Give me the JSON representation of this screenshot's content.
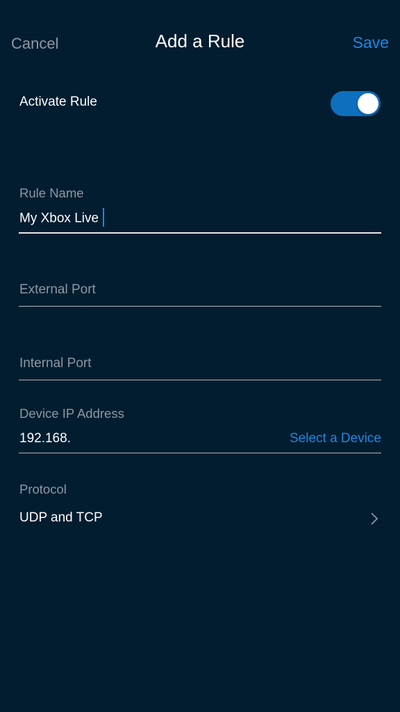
{
  "nav": {
    "cancel_label": "Cancel",
    "title": "Add a Rule",
    "save_label": "Save"
  },
  "activate": {
    "label": "Activate Rule",
    "enabled": true
  },
  "rule_name": {
    "label": "Rule Name",
    "value": "My Xbox Live"
  },
  "external_port": {
    "placeholder": "External Port",
    "value": ""
  },
  "internal_port": {
    "placeholder": "Internal Port",
    "value": ""
  },
  "device_ip": {
    "label": "Device IP Address",
    "value": "192.168.",
    "select_label": "Select a Device"
  },
  "protocol": {
    "label": "Protocol",
    "value": "UDP and TCP",
    "icon": "chevron-right-icon"
  },
  "colors": {
    "background": "#021d30",
    "accent": "#1e88e5",
    "toggle_on": "#0e6fbf",
    "secondary_text": "#8d98a3"
  }
}
